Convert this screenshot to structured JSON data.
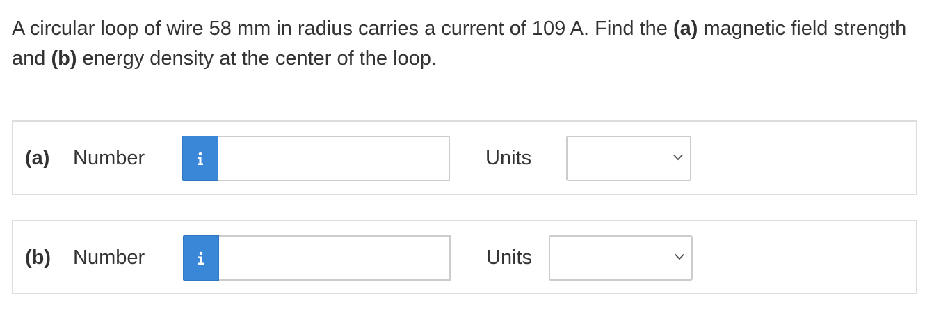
{
  "question": {
    "part1": "A circular loop of wire 58 mm in radius carries a current of 109 A. Find the ",
    "bold_a": "(a)",
    "part2": " magnetic field strength and ",
    "bold_b": "(b)",
    "part3": " energy density at the center of the loop."
  },
  "answers": [
    {
      "part_label": "(a)",
      "number_label": "Number",
      "info_icon": "info-icon",
      "number_value": "",
      "units_label": "Units",
      "units_selected": ""
    },
    {
      "part_label": "(b)",
      "number_label": "Number",
      "info_icon": "info-icon",
      "number_value": "",
      "units_label": "Units",
      "units_selected": ""
    }
  ],
  "colors": {
    "info_button": "#3a87d8",
    "border": "#dddddd",
    "input_border": "#cccccc",
    "text": "#333333"
  }
}
